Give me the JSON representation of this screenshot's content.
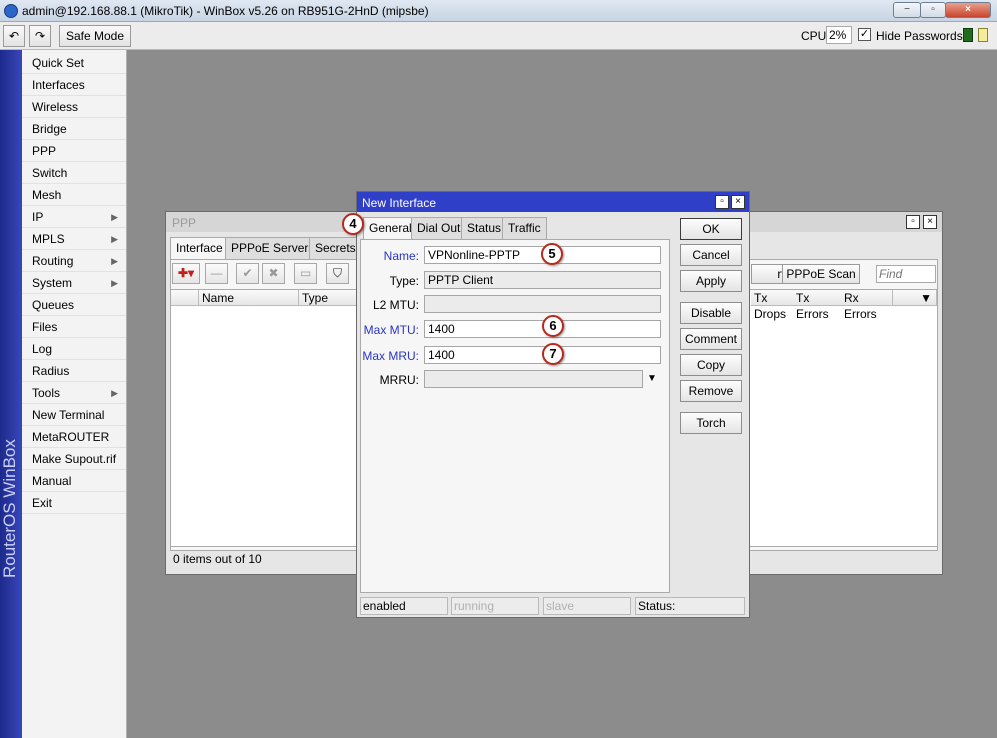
{
  "window": {
    "title": "admin@192.168.88.1 (MikroTik) - WinBox v5.26 on RB951G-2HnD (mipsbe)",
    "controls": [
      "−",
      "▫",
      "×"
    ]
  },
  "toolbar": {
    "undo_glyph": "↶",
    "redo_glyph": "↷",
    "safe_mode_label": "Safe Mode",
    "cpu_label": "CPU:",
    "cpu_value": "2%",
    "hide_passwords_label": "Hide Passwords",
    "hide_passwords_checked": true,
    "check_glyph": "✓"
  },
  "brand": {
    "text": "RouterOS WinBox",
    "color": "#2b3aa8"
  },
  "sidebar": {
    "items": [
      {
        "label": "Quick Set",
        "submenu": false
      },
      {
        "label": "Interfaces",
        "submenu": false
      },
      {
        "label": "Wireless",
        "submenu": false
      },
      {
        "label": "Bridge",
        "submenu": false
      },
      {
        "label": "PPP",
        "submenu": false
      },
      {
        "label": "Switch",
        "submenu": false
      },
      {
        "label": "Mesh",
        "submenu": false
      },
      {
        "label": "IP",
        "submenu": true
      },
      {
        "label": "MPLS",
        "submenu": true
      },
      {
        "label": "Routing",
        "submenu": true
      },
      {
        "label": "System",
        "submenu": true
      },
      {
        "label": "Queues",
        "submenu": false
      },
      {
        "label": "Files",
        "submenu": false
      },
      {
        "label": "Log",
        "submenu": false
      },
      {
        "label": "Radius",
        "submenu": false
      },
      {
        "label": "Tools",
        "submenu": true
      },
      {
        "label": "New Terminal",
        "submenu": false
      },
      {
        "label": "MetaROUTER",
        "submenu": false
      },
      {
        "label": "Make Supout.rif",
        "submenu": false
      },
      {
        "label": "Manual",
        "submenu": false
      },
      {
        "label": "Exit",
        "submenu": false
      }
    ],
    "submenu_glyph": "▶"
  },
  "ppp": {
    "title": "PPP",
    "tabs": [
      "Interface",
      "PPPoE Servers",
      "Secrets"
    ],
    "add_glyph": "✚▾",
    "remove_glyph": "—",
    "enable_glyph": "✔",
    "disable_glyph": "✖",
    "comment_glyph": "▭",
    "filter_glyph": "⛉",
    "columns_left": [
      "Name",
      "Type"
    ],
    "columns_right": [
      "Tx Drops",
      "Tx Errors",
      "Rx Errors"
    ],
    "dropdown_glyph": "▼",
    "server_btn": "rver",
    "pppoe_scan_btn": "PPPoE Scan",
    "find_placeholder": "Find",
    "footer": "0 items out of 10",
    "controls": [
      "▫",
      "×"
    ]
  },
  "dialog": {
    "title": "New Interface",
    "controls": [
      "▫",
      "×"
    ],
    "tabs": [
      "General",
      "Dial Out",
      "Status",
      "Traffic"
    ],
    "fields": {
      "name": {
        "label": "Name:",
        "value": "VPNonline-PPTP"
      },
      "type": {
        "label": "Type:",
        "value": "PPTP Client"
      },
      "l2mtu": {
        "label": "L2 MTU:",
        "value": ""
      },
      "max_mtu": {
        "label": "Max MTU:",
        "value": "1400"
      },
      "max_mru": {
        "label": "Max MRU:",
        "value": "1400"
      },
      "mrru": {
        "label": "MRRU:",
        "value": ""
      }
    },
    "mrru_dropdown_glyph": "▼",
    "buttons": {
      "ok": "OK",
      "cancel": "Cancel",
      "apply": "Apply",
      "disable": "Disable",
      "comment": "Comment",
      "copy": "Copy",
      "remove": "Remove",
      "torch": "Torch"
    },
    "status": {
      "enabled": "enabled",
      "running": "running",
      "slave": "slave",
      "status": "Status:"
    }
  },
  "annotations": [
    "4",
    "5",
    "6",
    "7"
  ]
}
